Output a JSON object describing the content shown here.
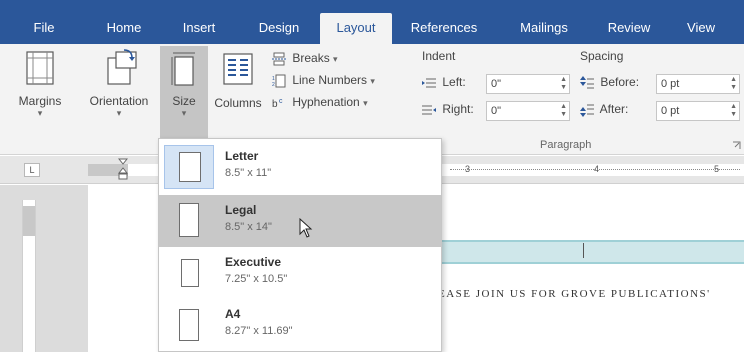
{
  "tabs": [
    {
      "label": "File",
      "active": false
    },
    {
      "label": "Home",
      "active": false
    },
    {
      "label": "Insert",
      "active": false
    },
    {
      "label": "Design",
      "active": false
    },
    {
      "label": "Layout",
      "active": true
    },
    {
      "label": "References",
      "active": false
    },
    {
      "label": "Mailings",
      "active": false
    },
    {
      "label": "Review",
      "active": false
    },
    {
      "label": "View",
      "active": false
    }
  ],
  "ribbon": {
    "margins": "Margins",
    "orientation": "Orientation",
    "size": "Size",
    "columns": "Columns",
    "breaks": "Breaks",
    "line_numbers": "Line Numbers",
    "hyphenation": "Hyphenation",
    "indent": {
      "title": "Indent",
      "left_label": "Left:",
      "left_value": "0\"",
      "right_label": "Right:",
      "right_value": "0\""
    },
    "spacing": {
      "title": "Spacing",
      "before_label": "Before:",
      "before_value": "0 pt",
      "after_label": "After:",
      "after_value": "0 pt"
    },
    "paragraph_group": "Paragraph",
    "dropdown_arrow": "▾"
  },
  "ruler": {
    "tab_selector": "L",
    "marks": [
      "3",
      "4",
      "5"
    ]
  },
  "size_menu": {
    "options": [
      {
        "name": "Letter",
        "dims": "8.5\" x 11\"",
        "state": "current"
      },
      {
        "name": "Legal",
        "dims": "8.5\" x 14\"",
        "state": "hover"
      },
      {
        "name": "Executive",
        "dims": "7.25\" x 10.5\"",
        "state": "normal"
      },
      {
        "name": "A4",
        "dims": "8.27\" x 11.69\"",
        "state": "normal"
      }
    ]
  },
  "document": {
    "visible_text": "EASE JOIN US FOR GROVE PUBLICATIONS'"
  },
  "colors": {
    "accent": "#2b579a",
    "ribbon_bg": "#f3f3f3",
    "hover_bg": "#c8c8c8",
    "band": "#cfe7ea"
  },
  "icons": {
    "margins": "margins-icon",
    "orientation": "orientation-icon",
    "size": "size-icon",
    "columns": "columns-icon",
    "breaks": "breaks-icon",
    "line_numbers": "line-numbers-icon",
    "hyphenation": "hyphenation-icon",
    "mouse": "mouse-pointer-icon"
  }
}
